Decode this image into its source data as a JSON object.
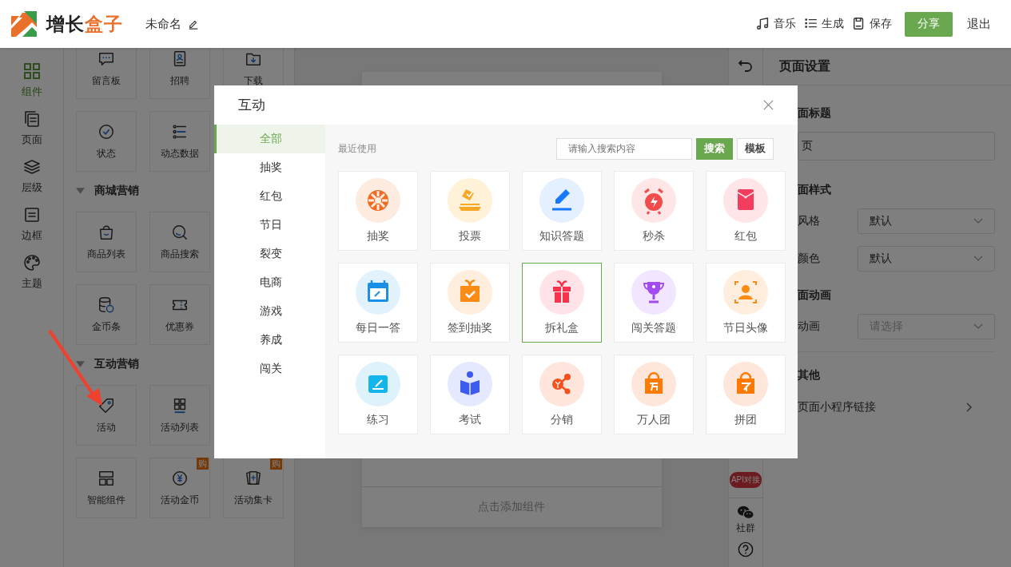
{
  "header": {
    "logo_main": "增长",
    "logo_accent": "盒子",
    "doc_title": "未命名",
    "actions": [
      {
        "label": "音乐",
        "kind": "music"
      },
      {
        "label": "生成",
        "kind": "list"
      },
      {
        "label": "保存",
        "kind": "save"
      }
    ],
    "share": "分享",
    "exit": "退出"
  },
  "rail": [
    {
      "label": "组件",
      "selected": true
    },
    {
      "label": "页面",
      "selected": false
    },
    {
      "label": "层级",
      "selected": false
    },
    {
      "label": "边框",
      "selected": false
    },
    {
      "label": "主题",
      "selected": false
    }
  ],
  "palette": {
    "groups": [
      {
        "rows": [
          [
            {
              "label": "留言板"
            },
            {
              "label": "招聘"
            },
            {
              "label": "下载"
            }
          ],
          [
            {
              "label": "状态"
            },
            {
              "label": "动态数据"
            }
          ]
        ]
      },
      {
        "title": "商城营销",
        "rows": [
          [
            {
              "label": "商品列表"
            },
            {
              "label": "商品搜索"
            }
          ],
          [
            {
              "label": "金币条"
            },
            {
              "label": "优惠券"
            }
          ]
        ]
      },
      {
        "title": "互动营销",
        "rows": [
          [
            {
              "label": "活动"
            },
            {
              "label": "活动列表"
            }
          ],
          [
            {
              "label": "智能组件"
            },
            {
              "label": "活动金币",
              "badge": "购"
            },
            {
              "label": "活动集卡",
              "badge": "购"
            }
          ]
        ]
      }
    ]
  },
  "canvas": {
    "add_hint": "点击添加组件"
  },
  "tools": {
    "api_badge": "API对接",
    "community": "社群"
  },
  "settings": {
    "title": "页面设置",
    "sections": [
      {
        "heading": "面标题",
        "fields": [
          {
            "kind": "input",
            "value": "页"
          }
        ]
      },
      {
        "heading": "面样式",
        "fields": [
          {
            "kind": "select",
            "label": "风格",
            "value": "默认"
          },
          {
            "kind": "select",
            "label": "颜色",
            "value": "默认"
          }
        ]
      },
      {
        "heading": "面动画",
        "fields": [
          {
            "kind": "select",
            "label": "动画",
            "placeholder": "请选择"
          }
        ]
      },
      {
        "heading": "其他",
        "fields": [
          {
            "kind": "link",
            "label": "页面小程序链接"
          }
        ]
      }
    ]
  },
  "modal": {
    "title": "互动",
    "categories": [
      {
        "label": "全部",
        "selected": true
      },
      {
        "label": "抽奖",
        "selected": false
      },
      {
        "label": "红包",
        "selected": false
      },
      {
        "label": "节日",
        "selected": false
      },
      {
        "label": "裂变",
        "selected": false
      },
      {
        "label": "电商",
        "selected": false
      },
      {
        "label": "游戏",
        "selected": false
      },
      {
        "label": "养成",
        "selected": false
      },
      {
        "label": "闯关",
        "selected": false
      }
    ],
    "recent_label": "最近使用",
    "search": {
      "placeholder": "请输入搜索内容"
    },
    "search_button": "搜索",
    "template_button": "模板",
    "items": [
      {
        "label": "抽奖",
        "selected": false
      },
      {
        "label": "投票",
        "selected": false
      },
      {
        "label": "知识答题",
        "selected": false
      },
      {
        "label": "秒杀",
        "selected": false
      },
      {
        "label": "红包",
        "selected": false
      },
      {
        "label": "每日一答",
        "selected": false
      },
      {
        "label": "签到抽奖",
        "selected": false
      },
      {
        "label": "拆礼盒",
        "selected": true
      },
      {
        "label": "闯关答题",
        "selected": false
      },
      {
        "label": "节日头像",
        "selected": false
      },
      {
        "label": "练习",
        "selected": false
      },
      {
        "label": "考试",
        "selected": false
      },
      {
        "label": "分销",
        "selected": false
      },
      {
        "label": "万人团",
        "selected": false
      },
      {
        "label": "拼团",
        "selected": false
      }
    ]
  }
}
